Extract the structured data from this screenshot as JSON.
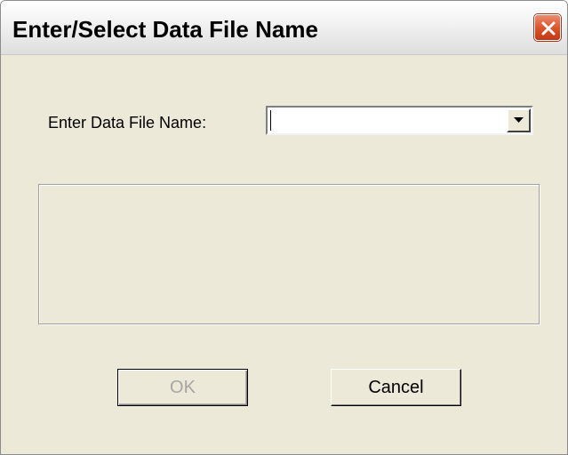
{
  "window": {
    "title": "Enter/Select Data File Name"
  },
  "form": {
    "file_name_label": "Enter Data File Name:",
    "file_name_value": "",
    "file_name_placeholder": ""
  },
  "buttons": {
    "ok_label": "OK",
    "ok_enabled": false,
    "cancel_label": "Cancel"
  },
  "icons": {
    "close": "close-icon",
    "dropdown": "chevron-down-icon"
  },
  "colors": {
    "close_button": "#d9522a",
    "dialog_background": "#ece9d8",
    "disabled_text": "#a6a6a6"
  }
}
